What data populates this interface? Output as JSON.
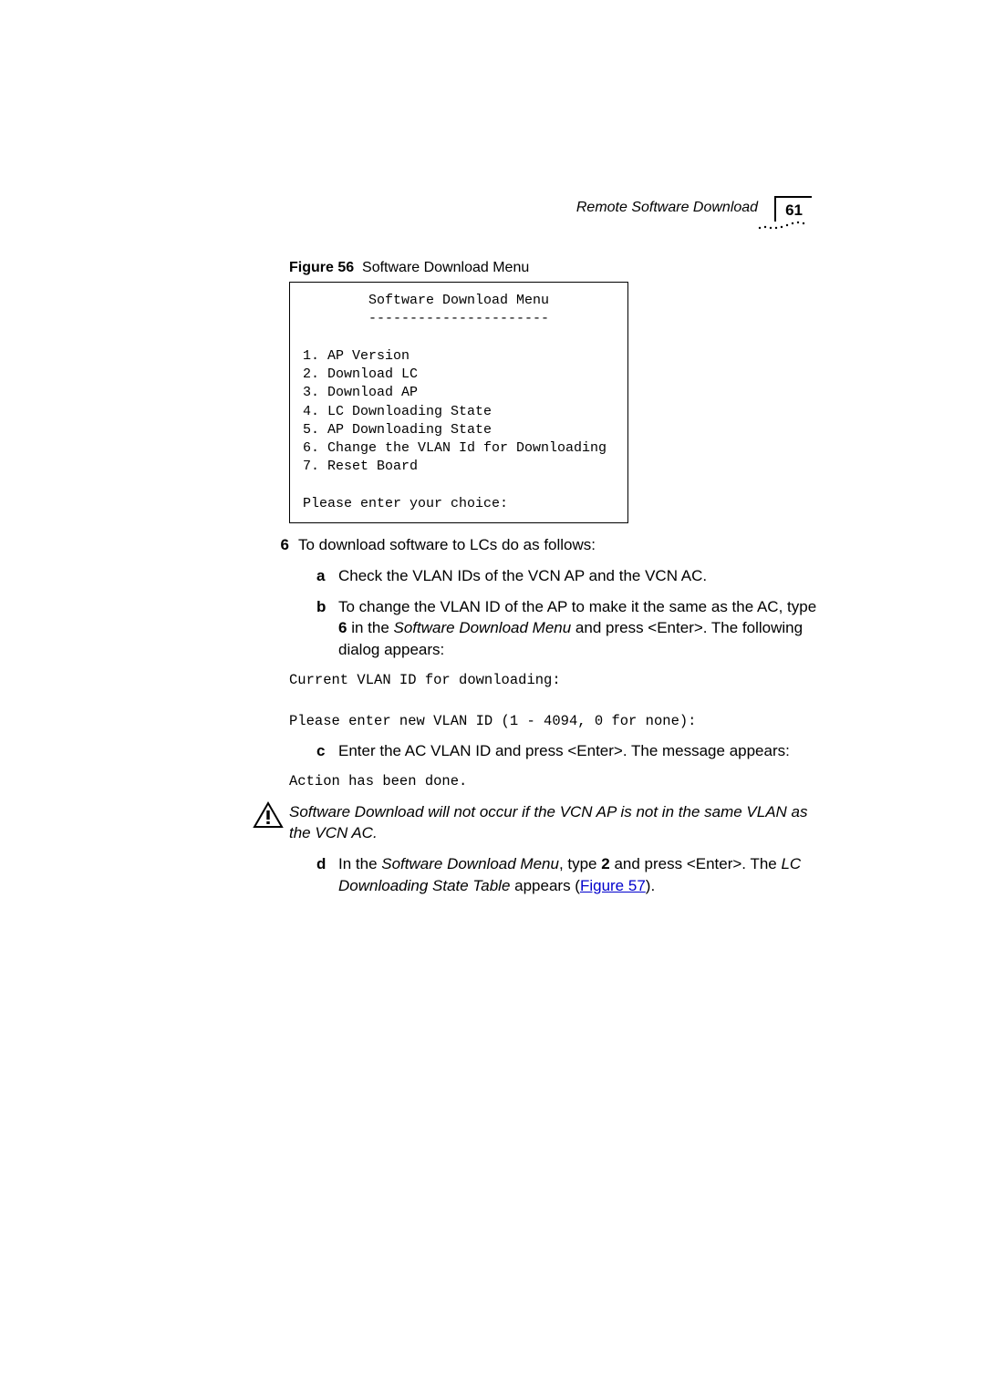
{
  "header": {
    "title": "Remote Software Download",
    "page_number": "61"
  },
  "figure56": {
    "label_bold": "Figure 56",
    "label_rest": "Software Download Menu",
    "code": "        Software Download Menu\n        ----------------------\n\n1. AP Version\n2. Download LC\n3. Download AP\n4. LC Downloading State\n5. AP Downloading State\n6. Change the VLAN Id for Downloading\n7. Reset Board\n\nPlease enter your choice:"
  },
  "step6": {
    "num": "6",
    "text": "To download software to LCs do as follows:",
    "a": {
      "letter": "a",
      "text": "Check the VLAN IDs of the VCN AP and the VCN AC."
    },
    "b": {
      "letter": "b",
      "pre": "To change the VLAN ID of the AP to make it the same as the AC, type ",
      "boldkey": "6",
      "mid": " in the ",
      "ital": "Software Download Menu",
      "post": " and press <Enter>. The following dialog appears:"
    },
    "mono1": "Current VLAN ID for downloading:\n\nPlease enter new VLAN ID (1 - 4094, 0 for none):",
    "c": {
      "letter": "c",
      "text": "Enter the AC VLAN ID and press <Enter>. The message appears:"
    },
    "mono2": "Action has been done.",
    "caution": "Software Download will not occur if the VCN AP is not in the same VLAN as the VCN AC.",
    "d": {
      "letter": "d",
      "pre": "In the ",
      "ital1": "Software Download Menu",
      "mid1": ", type ",
      "boldkey": "2",
      "mid2": " and press <Enter>. The ",
      "ital2": "LC Downloading State Table",
      "mid3": " appears (",
      "linktext": "Figure 57",
      "post": ")."
    }
  }
}
